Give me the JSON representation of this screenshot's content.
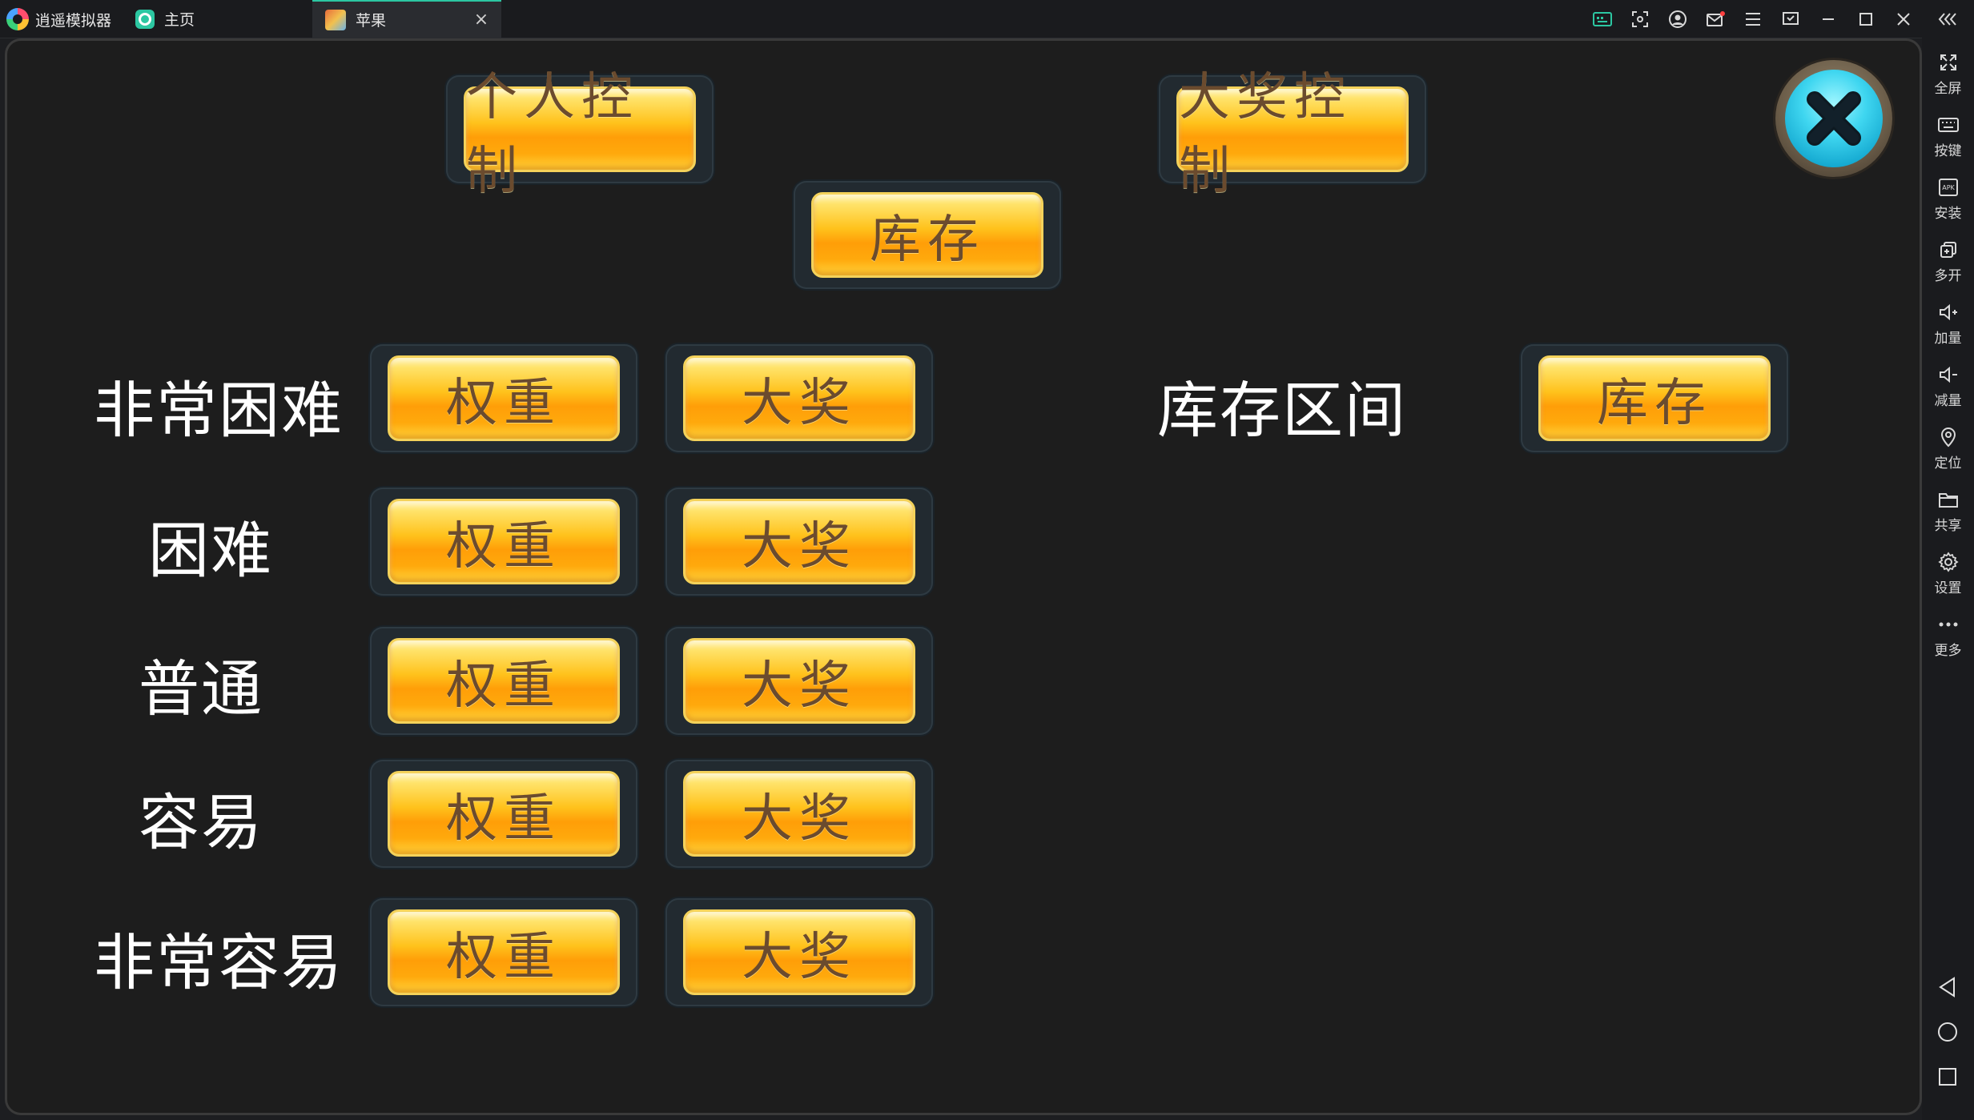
{
  "window": {
    "app_name": "逍遥模拟器",
    "tabs": [
      {
        "label": "主页"
      },
      {
        "label": "苹果"
      }
    ],
    "tab_close_symbol": "×"
  },
  "titlebar_icons": [
    {
      "name": "keyboard-mapping-icon"
    },
    {
      "name": "screenshot-icon"
    },
    {
      "name": "account-icon"
    },
    {
      "name": "mail-icon"
    },
    {
      "name": "menu-icon"
    },
    {
      "name": "operation-record-icon"
    },
    {
      "name": "minimize-icon"
    },
    {
      "name": "maximize-icon"
    },
    {
      "name": "close-window-icon"
    },
    {
      "name": "collapse-sidebar-icon"
    }
  ],
  "sidebar": {
    "items": [
      {
        "label": "全屏",
        "icon": "fullscreen-icon"
      },
      {
        "label": "按键",
        "icon": "keyboard-icon"
      },
      {
        "label": "安装",
        "icon": "apk-install-icon"
      },
      {
        "label": "多开",
        "icon": "multi-instance-icon"
      },
      {
        "label": "加量",
        "icon": "volume-up-icon"
      },
      {
        "label": "减量",
        "icon": "volume-down-icon"
      },
      {
        "label": "定位",
        "icon": "location-icon"
      },
      {
        "label": "共享",
        "icon": "shared-folder-icon"
      },
      {
        "label": "设置",
        "icon": "settings-icon"
      },
      {
        "label": "更多",
        "icon": "more-icon"
      }
    ],
    "nav": [
      {
        "icon": "back-icon"
      },
      {
        "icon": "home-circle-icon"
      },
      {
        "icon": "recent-apps-icon"
      }
    ]
  },
  "game": {
    "top_buttons": {
      "personal_control": "个人控制",
      "jackpot_control": "大奖控制",
      "inventory": "库存"
    },
    "rows": [
      {
        "label": "非常困难",
        "weight_button": "权重",
        "jackpot_button": "大奖"
      },
      {
        "label": "困难",
        "weight_button": "权重",
        "jackpot_button": "大奖"
      },
      {
        "label": "普通",
        "weight_button": "权重",
        "jackpot_button": "大奖"
      },
      {
        "label": "容易",
        "weight_button": "权重",
        "jackpot_button": "大奖"
      },
      {
        "label": "非常容易",
        "weight_button": "权重",
        "jackpot_button": "大奖"
      }
    ],
    "inventory_range": {
      "label": "库存区间",
      "button": "库存"
    }
  },
  "colors": {
    "accent": "#2cc7a2",
    "button_gold": "#ffc21c",
    "button_text": "#6b4b2e",
    "close_cyan": "#3fd6f0"
  }
}
